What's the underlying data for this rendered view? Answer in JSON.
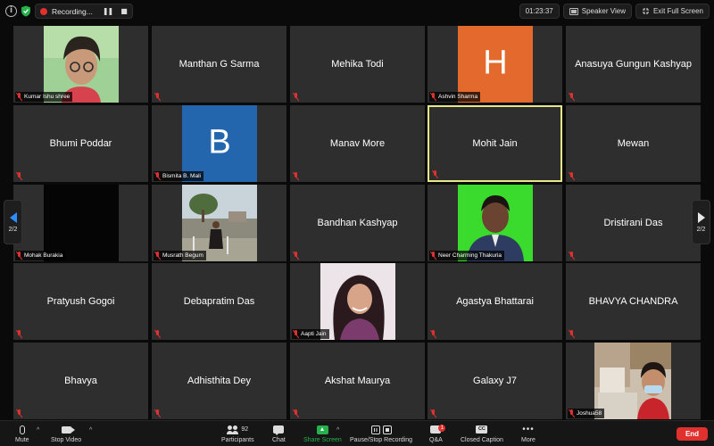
{
  "top_bar": {
    "recording_label": "Recording...",
    "timer": "01:23:37",
    "speaker_view_label": "Speaker View",
    "exit_fullscreen_label": "Exit Full Screen"
  },
  "gallery": {
    "rows": [
      [
        {
          "name": "",
          "caption": "Kumar Ishu shree",
          "video": true
        },
        {
          "name": "Manthan G Sarma",
          "caption": ""
        },
        {
          "name": "Mehika Todi",
          "caption": ""
        },
        {
          "name": "",
          "caption": "Ashvin Sharma",
          "avatar_letter": "H",
          "avatar_color": "#e3692c"
        },
        {
          "name": "Anasuya Gungun Kashyap",
          "caption": ""
        }
      ],
      [
        {
          "name": "Bhumi Poddar",
          "caption": ""
        },
        {
          "name": "",
          "caption": "Bismita B. Mali",
          "avatar_letter": "B",
          "avatar_color": "#2466ad"
        },
        {
          "name": "Manav More",
          "caption": ""
        },
        {
          "name": "Mohit Jain",
          "caption": "",
          "active_speaker": true
        },
        {
          "name": "Mewan",
          "caption": ""
        }
      ],
      [
        {
          "name": "",
          "caption": "Mohak Burakia",
          "video": true
        },
        {
          "name": "",
          "caption": "Musrath Begum",
          "video": true
        },
        {
          "name": "Bandhan Kashyap",
          "caption": ""
        },
        {
          "name": "",
          "caption": "Neer Charming Thakuria",
          "video": true
        },
        {
          "name": "Dristirani Das",
          "caption": ""
        }
      ],
      [
        {
          "name": "Pratyush Gogoi",
          "caption": ""
        },
        {
          "name": "Debapratim Das",
          "caption": ""
        },
        {
          "name": "",
          "caption": "Aapti Jain",
          "video": true
        },
        {
          "name": "Agastya Bhattarai",
          "caption": ""
        },
        {
          "name": "BHAVYA CHANDRA",
          "caption": ""
        }
      ],
      [
        {
          "name": "Bhavya",
          "caption": ""
        },
        {
          "name": "Adhisthita Dey",
          "caption": ""
        },
        {
          "name": "Akshat Maurya",
          "caption": ""
        },
        {
          "name": "Galaxy J7",
          "caption": ""
        },
        {
          "name": "",
          "caption": "Joshua58",
          "video": true
        }
      ]
    ],
    "page_indicator": "2/2"
  },
  "toolbar": {
    "mute": "Mute",
    "stop_video": "Stop Video",
    "participants": "Participants",
    "participants_count": "92",
    "chat": "Chat",
    "share_screen": "Share Screen",
    "pause_stop_recording": "Pause/Stop Recording",
    "qa": "Q&A",
    "qa_badge": "1",
    "closed_caption": "Closed Caption",
    "cc_icon_text": "CC",
    "more": "More",
    "end": "End"
  },
  "colors": {
    "accent_blue": "#2d8cff",
    "record_red": "#e0312f",
    "share_green": "#26b14c",
    "active_speaker_border": "#e6e887",
    "tile_bg": "#2e2e2e"
  }
}
